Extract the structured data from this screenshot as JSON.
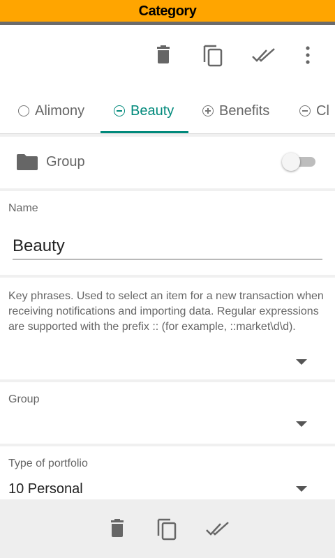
{
  "window": {
    "title": "Category",
    "title_bg": "#ffa500",
    "accent": "#00897b"
  },
  "toolbar": {
    "icons": [
      "delete-icon",
      "copy-icon",
      "done-all-icon",
      "more-vert-icon"
    ]
  },
  "tabs": [
    {
      "label": "Alimony",
      "icon": "radio-empty-icon",
      "active": false
    },
    {
      "label": "Beauty",
      "icon": "minus-circle-icon",
      "active": true
    },
    {
      "label": "Benefits",
      "icon": "plus-circle-icon",
      "active": false
    },
    {
      "label": "Cl",
      "icon": "minus-circle-icon",
      "active": false
    }
  ],
  "group_card": {
    "label": "Group",
    "toggle_on": false
  },
  "name_field": {
    "label": "Name",
    "value": "Beauty"
  },
  "phrases_field": {
    "hint": "Key phrases. Used to select an item for a new transaction when receiving notifications and importing data. Regular expressions are supported with the prefix :: (for example, ::market\\d\\d)."
  },
  "group_field": {
    "label": "Group",
    "value": ""
  },
  "portfolio_field": {
    "label": "Type of portfolio",
    "value": "10 Personal"
  },
  "bottombar": {
    "icons": [
      "delete-icon",
      "copy-icon",
      "done-all-icon"
    ]
  }
}
